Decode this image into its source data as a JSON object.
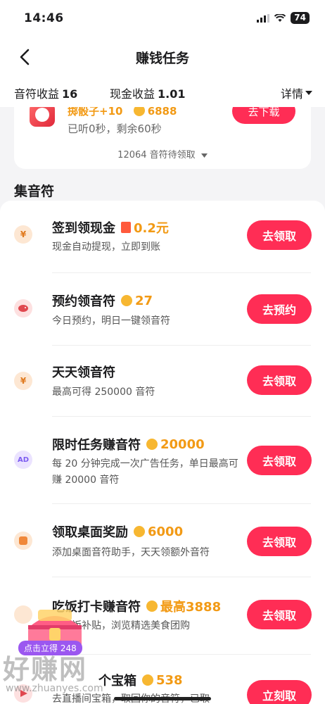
{
  "status_bar": {
    "time": "14:46",
    "battery": "74"
  },
  "nav": {
    "title": "赚钱任务"
  },
  "summary": {
    "notes_label": "音符收益",
    "notes_value": "16",
    "cash_label": "现金收益",
    "cash_value": "1.01",
    "detail_label": "详情"
  },
  "top_card": {
    "task_text": "掷骰子+10",
    "coin_value": "6888",
    "download_label": "去下载",
    "progress_text": "已听0秒，剩余60秒",
    "pending_text": "12064 音符待领取"
  },
  "section_title": "集音符",
  "tasks": [
    {
      "title": "签到领现金",
      "reward": "0.2元",
      "desc": "现金自动提现，立即到账",
      "button": "去领取",
      "icon": "yen-coin-icon"
    },
    {
      "title": "预约领音符",
      "reward": "27",
      "desc": "今日预约，明日一键领音符",
      "button": "去预约",
      "icon": "piggy-bank-icon"
    },
    {
      "title": "天天领音符",
      "reward": "",
      "desc": "最高可得 250000 音符",
      "button": "去领取",
      "icon": "yen-coin-icon"
    },
    {
      "title": "限时任务赚音符",
      "reward": "20000",
      "desc": "每 20 分钟完成一次广告任务，单日最高可赚 20000 音符",
      "button": "去领取",
      "icon": "ad-icon"
    },
    {
      "title": "领取桌面奖励",
      "reward": "6000",
      "desc": "添加桌面音符助手，天天领额外音符",
      "button": "去领取",
      "icon": "desktop-widget-icon"
    },
    {
      "title": "吃饭打卡赚音符",
      "reward": "最高3888",
      "desc": "领吃饭补贴，浏览精选美食团购",
      "button": "去领取",
      "icon": "meal-icon"
    },
    {
      "title": "个宝箱",
      "reward": "538",
      "desc": "去直播间宝箱，取回你的音符，已取",
      "button": "立刻取",
      "icon": "video-icon"
    }
  ],
  "floating": {
    "chest_label": "点击立得 248"
  },
  "watermark": {
    "logo": "好赚网",
    "url": "www.zhuanyes.com"
  },
  "colors": {
    "accent": "#ff2d55",
    "reward": "#f29a15",
    "ad_purple": "#9b57f0"
  }
}
